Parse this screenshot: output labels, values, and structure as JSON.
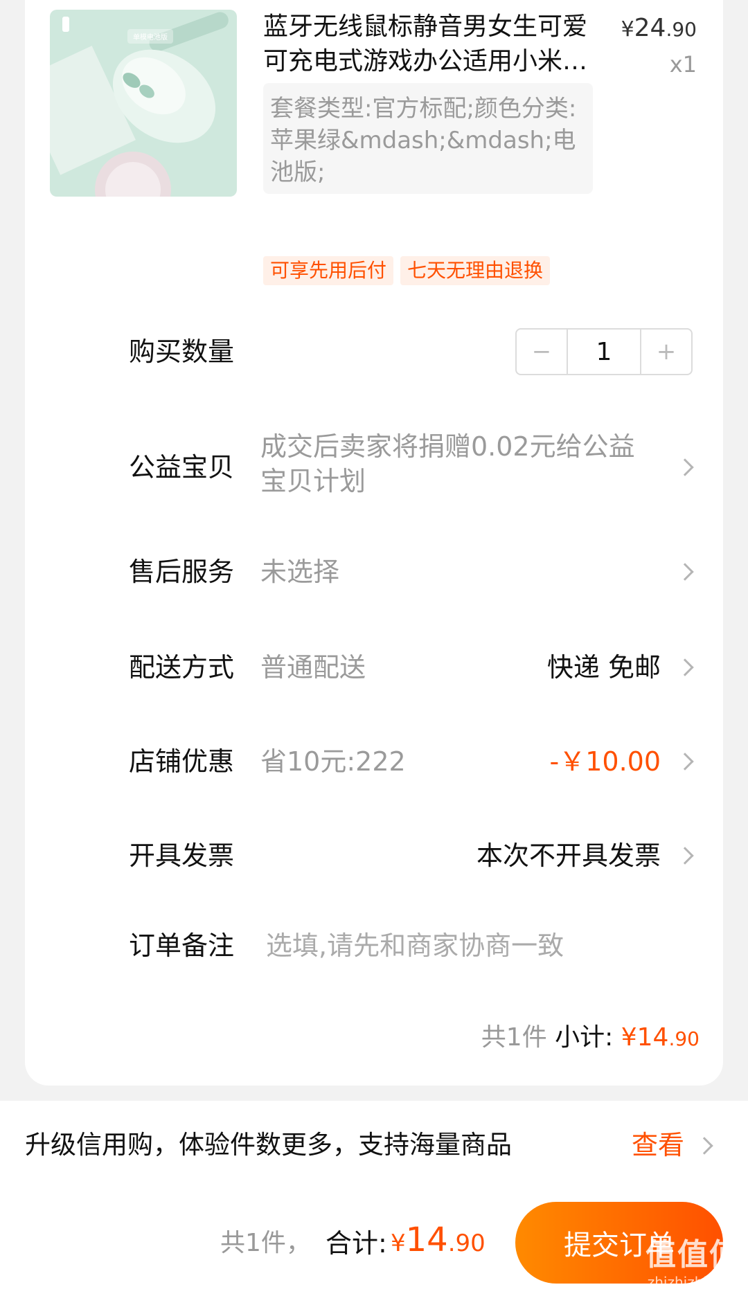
{
  "product": {
    "thumb_tag": "单模电池版",
    "title": "蓝牙无线鼠标静音男女生可爱可充电式游戏办公适用小米…",
    "price_currency": "¥",
    "price_int": "24",
    "price_dec": ".90",
    "quantity_mult": "x1",
    "sku": "套餐类型:官方标配;颜色分类:苹果绿&mdash;&mdash;电池版;",
    "tags": [
      "可享先用后付",
      "七天无理由退换"
    ]
  },
  "rows": {
    "qty": {
      "label": "购买数量",
      "value": "1",
      "minus": "−",
      "plus": "+"
    },
    "charity": {
      "label": "公益宝贝",
      "desc": "成交后卖家将捐赠0.02元给公益宝贝计划"
    },
    "after_sales": {
      "label": "售后服务",
      "desc": "未选择"
    },
    "delivery": {
      "label": "配送方式",
      "desc": "普通配送",
      "value": "快递 免邮"
    },
    "discount": {
      "label": "店铺优惠",
      "desc": "省10元:222",
      "value": "-￥10.00"
    },
    "invoice": {
      "label": "开具发票",
      "value": "本次不开具发票"
    },
    "note": {
      "label": "订单备注",
      "placeholder": "选填,请先和商家协商一致"
    }
  },
  "subtotal": {
    "count": "共1件",
    "label": "小计:",
    "currency": "¥",
    "int": "14",
    "dec": ".90"
  },
  "upgrade": {
    "text": "升级信用购，体验件数更多，支持海量商品",
    "link": "查看"
  },
  "footer": {
    "count": "共1件，",
    "total_label": "合计:",
    "currency": "¥",
    "int": "14",
    "dec": ".90",
    "submit": "提交订单"
  },
  "watermark": {
    "big": "值值值",
    "small": "zhizhizhi.com"
  },
  "colors": {
    "accent": "#ff5000",
    "accent_light": "#ff8a00",
    "background": "#f2f2f2"
  }
}
